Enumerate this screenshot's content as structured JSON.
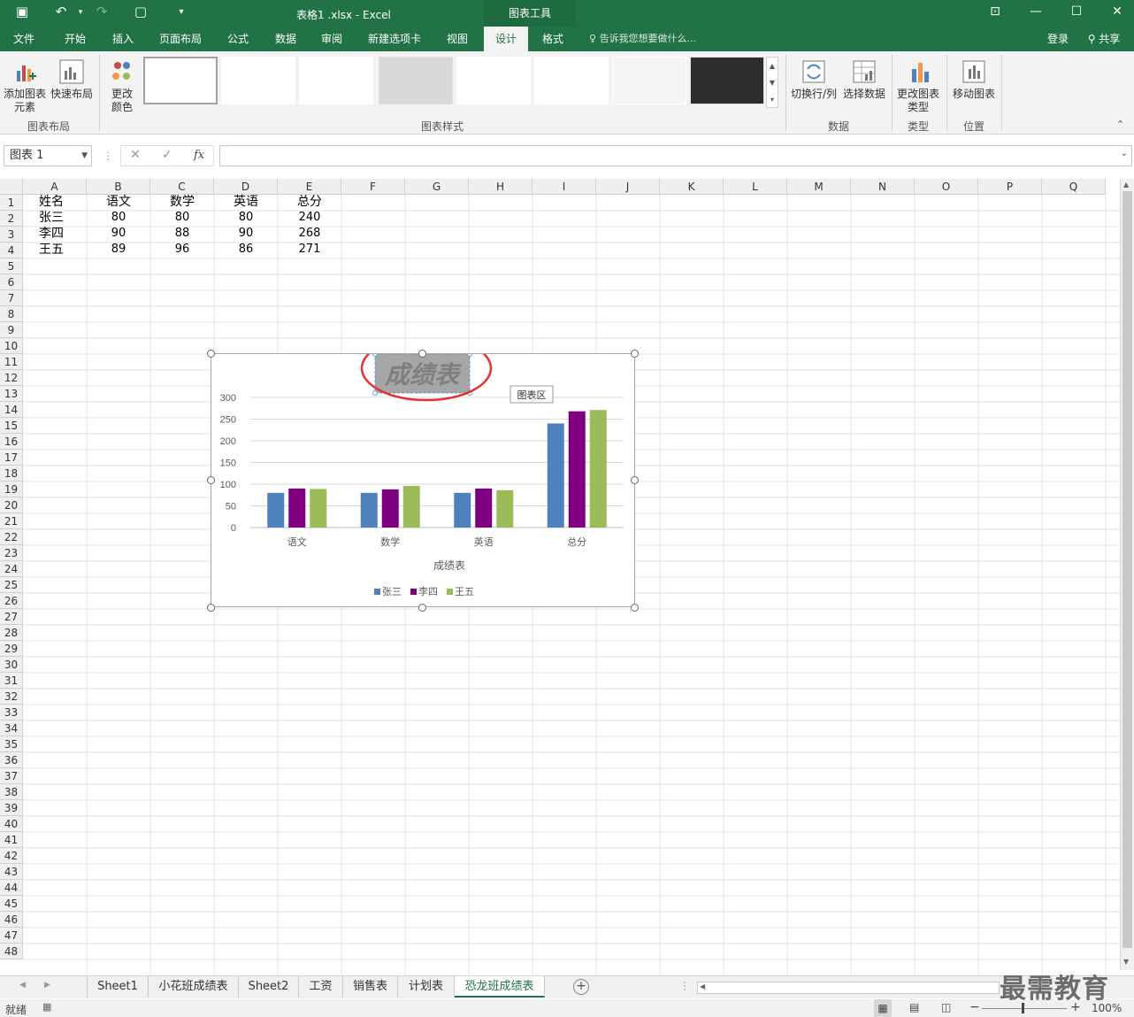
{
  "window": {
    "title": "表格1 .xlsx - Excel",
    "context_tab": "图表工具"
  },
  "tabs": [
    "文件",
    "开始",
    "插入",
    "页面布局",
    "公式",
    "数据",
    "审阅",
    "新建选项卡",
    "视图",
    "设计",
    "格式"
  ],
  "tell_me": "告诉我您想要做什么...",
  "account": {
    "login": "登录",
    "share": "共享"
  },
  "ribbon": {
    "add_element": "添加图表元素",
    "quick_layout": "快速布局",
    "change_color": "更改颜色",
    "group_layout": "图表布局",
    "group_styles": "图表样式",
    "switch_row_col": "切换行/列",
    "select_data": "选择数据",
    "group_data": "数据",
    "change_type": "更改图表类型",
    "group_type": "类型",
    "move_chart": "移动图表",
    "group_location": "位置"
  },
  "formula_bar": {
    "name_box": "图表 1",
    "fx": "fx"
  },
  "columns": [
    "A",
    "B",
    "C",
    "D",
    "E",
    "F",
    "G",
    "H",
    "I",
    "J",
    "K",
    "L",
    "M",
    "N",
    "O",
    "P",
    "Q"
  ],
  "table": {
    "header": [
      "姓名",
      "语文",
      "数学",
      "英语",
      "总分"
    ],
    "rows": [
      [
        "张三",
        "80",
        "80",
        "80",
        "240"
      ],
      [
        "李四",
        "90",
        "88",
        "90",
        "268"
      ],
      [
        "王五",
        "89",
        "96",
        "86",
        "271"
      ]
    ]
  },
  "chart_data": {
    "type": "bar",
    "title": "成绩表",
    "xlabel": "成绩表",
    "ylabel": "",
    "categories": [
      "语文",
      "数学",
      "英语",
      "总分"
    ],
    "series": [
      {
        "name": "张三",
        "values": [
          80,
          80,
          80,
          240
        ],
        "color": "#4f81bd"
      },
      {
        "name": "李四",
        "values": [
          90,
          88,
          90,
          268
        ],
        "color": "#7f007f"
      },
      {
        "name": "王五",
        "values": [
          89,
          96,
          86,
          271
        ],
        "color": "#9bbb59"
      }
    ],
    "ylim": [
      0,
      300
    ],
    "yticks": [
      0,
      50,
      100,
      150,
      200,
      250,
      300
    ],
    "grid": true,
    "legend": "bottom",
    "tooltip": "图表区"
  },
  "sheets": [
    "Sheet1",
    "小花班成绩表",
    "Sheet2",
    "工资",
    "销售表",
    "计划表",
    "恐龙班成绩表"
  ],
  "active_sheet": "恐龙班成绩表",
  "status": {
    "ready": "就绪",
    "zoom": "100%"
  },
  "watermark": "最需教育",
  "colors": {
    "excel_green": "#217346"
  }
}
